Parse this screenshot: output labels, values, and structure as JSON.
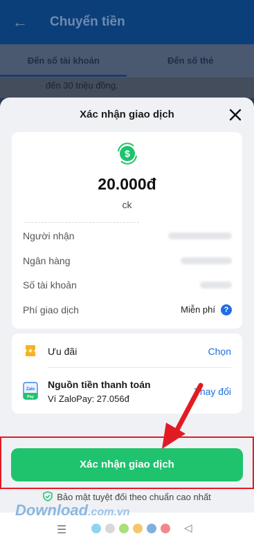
{
  "background": {
    "header_title": "Chuyển tiền",
    "tabs": [
      "Đến số tài khoản",
      "Đến số thẻ"
    ],
    "note": "đến 30 triệu đồng."
  },
  "sheet": {
    "title": "Xác nhận giao dịch",
    "amount": "20.000đ",
    "note": "ck",
    "rows": [
      {
        "label": "Người nhận",
        "value": ""
      },
      {
        "label": "Ngân hàng",
        "value": ""
      },
      {
        "label": "Số tài khoản",
        "value": ""
      },
      {
        "label": "Phí giao dịch",
        "value": "Miễn phí"
      }
    ],
    "promo": {
      "label": "Ưu đãi",
      "action": "Chọn"
    },
    "source": {
      "title": "Nguồn tiền thanh toán",
      "subtitle": "Ví ZaloPay: 27.056đ",
      "action": "Thay đổi"
    },
    "confirm_label": "Xác nhận giao dịch",
    "secure_text": "Bảo mật tuyệt đối theo chuẩn cao nhất"
  },
  "watermark": {
    "main": "Download",
    "suffix": ".com.vn"
  },
  "colors": {
    "accent_green": "#1fc36d",
    "link_blue": "#1f6fe0",
    "highlight_red": "#e21b23"
  },
  "icons": [
    "back-arrow-icon",
    "close-icon",
    "money-exchange-icon",
    "help-icon",
    "gift-icon",
    "zalopay-icon",
    "shield-icon",
    "menu-icon",
    "back-triangle-icon"
  ]
}
